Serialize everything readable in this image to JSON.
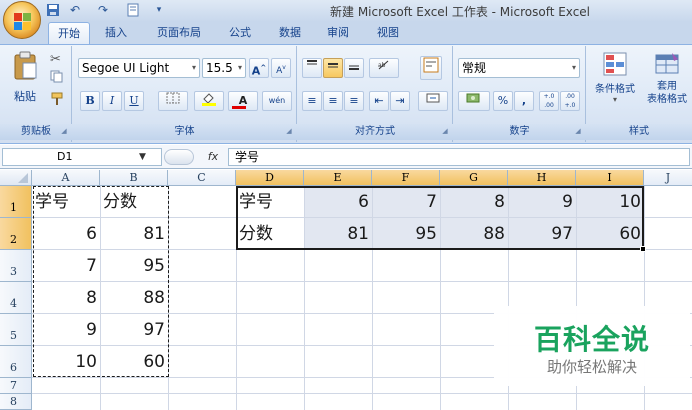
{
  "window": {
    "title": "新建 Microsoft Excel 工作表 - Microsoft Excel"
  },
  "qat": {
    "icons": [
      "save-icon",
      "undo-icon",
      "redo-icon",
      "print-preview-icon",
      "customize-icon"
    ]
  },
  "tabs": [
    "开始",
    "插入",
    "页面布局",
    "公式",
    "数据",
    "审阅",
    "视图"
  ],
  "ribbon": {
    "clipboard": {
      "paste_label": "粘贴",
      "group_label": "剪贴板"
    },
    "font": {
      "font_name": "Segoe UI Light",
      "font_size": "15.5",
      "grow_label": "A",
      "shrink_label": "A",
      "bold": "B",
      "italic": "I",
      "underline": "U",
      "font_color_label": "A",
      "phonetic_label": "wén",
      "group_label": "字体"
    },
    "alignment": {
      "group_label": "对齐方式"
    },
    "number": {
      "format": "常规",
      "percent": "%",
      "comma": ",",
      "inc_decimal": "+.0 .00",
      "dec_decimal": ".00 +.0",
      "group_label": "数字"
    },
    "styles": {
      "conditional_label": "条件格式",
      "table_format_label_1": "套用",
      "table_format_label_2": "表格格式",
      "group_label": "样式"
    }
  },
  "formula_bar": {
    "name_box": "D1",
    "fx": "fx",
    "formula": "学号"
  },
  "columns": [
    "A",
    "B",
    "C",
    "D",
    "E",
    "F",
    "G",
    "H",
    "I",
    "J"
  ],
  "rows": [
    "1",
    "2",
    "3",
    "4",
    "5",
    "6",
    "7",
    "8"
  ],
  "cells": {
    "A1": "学号",
    "B1": "分数",
    "A2": "6",
    "B2": "81",
    "A3": "7",
    "B3": "95",
    "A4": "8",
    "B4": "88",
    "A5": "9",
    "B5": "97",
    "A6": "10",
    "B6": "60",
    "D1": "学号",
    "E1": "6",
    "F1": "7",
    "G1": "8",
    "H1": "9",
    "I1": "10",
    "D2": "分数",
    "E2": "81",
    "F2": "95",
    "G2": "88",
    "H2": "97",
    "I2": "60"
  },
  "watermark": {
    "title": "百科全说",
    "subtitle": "助你轻松解决"
  },
  "colors": {
    "accent": "#15428b",
    "ribbon_bg": "#dde8f6",
    "selection": "#e2e7f1",
    "watermark_green": "#1aa35e"
  }
}
